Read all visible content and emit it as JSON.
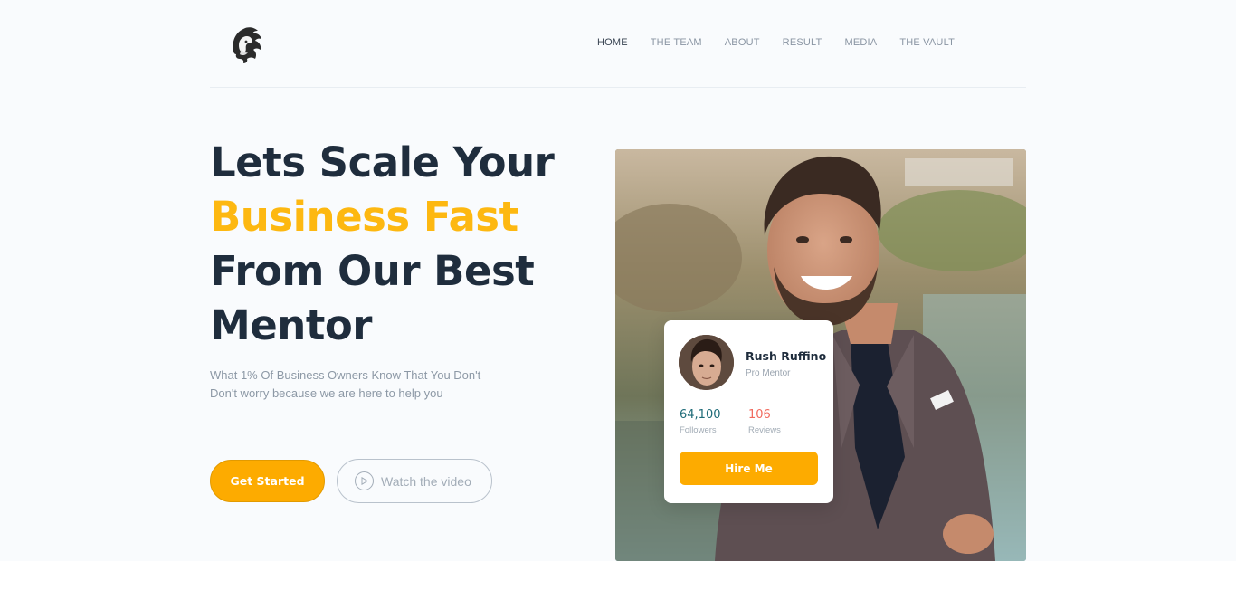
{
  "header": {
    "nav": [
      {
        "label": "HOME",
        "active": true
      },
      {
        "label": "THE TEAM"
      },
      {
        "label": "ABOUT"
      },
      {
        "label": "RESULT"
      },
      {
        "label": "MEDIA"
      },
      {
        "label": "THE VAULT"
      }
    ]
  },
  "hero": {
    "title_line1": "Lets Scale Your",
    "title_accent": "Business Fast",
    "title_line3": "From Our Best",
    "title_line4": "Mentor",
    "subtitle_line1": "What 1% Of Business Owners Know That You Don't",
    "subtitle_line2": "Don't worry because we are here to help you",
    "cta_primary": "Get Started",
    "cta_secondary": "Watch the video"
  },
  "mentor_card": {
    "name": "Rush Ruffino",
    "role": "Pro Mentor",
    "followers_value": "64,100",
    "followers_label": "Followers",
    "reviews_value": "106",
    "reviews_label": "Reviews",
    "hire_label": "Hire Me"
  },
  "colors": {
    "accent": "#fdb811",
    "button": "#fdab00",
    "heading": "#1f2d3d",
    "followers": "#1e6b78",
    "reviews": "#f16a5e"
  },
  "icons": {
    "logo": "lion-head-logo",
    "play": "play-icon"
  }
}
